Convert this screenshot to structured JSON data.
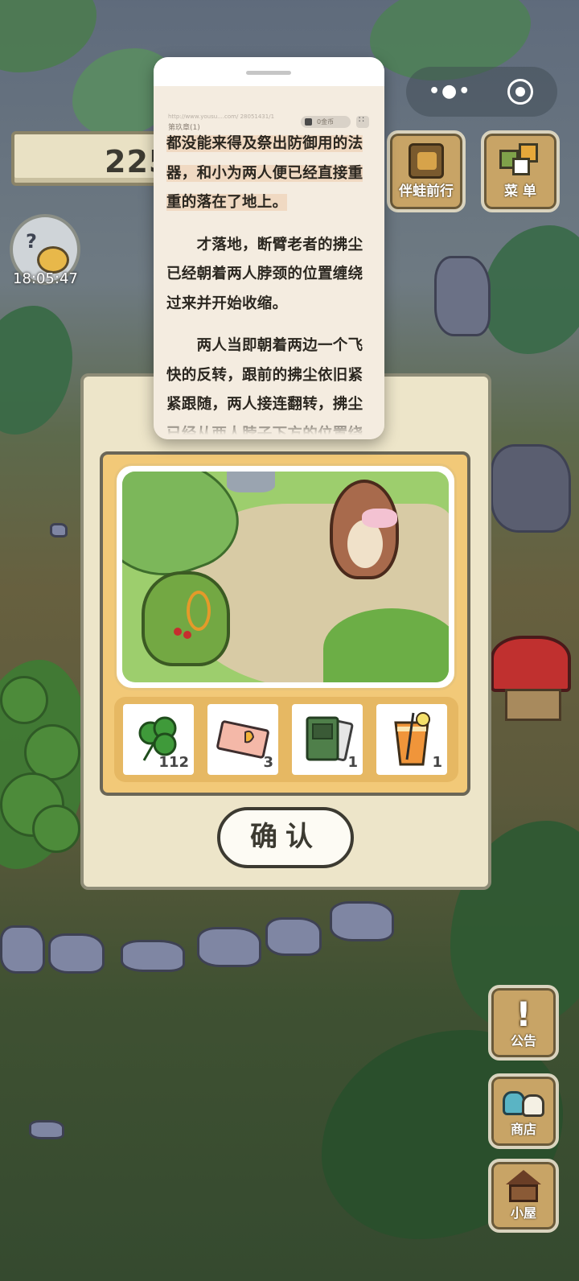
{
  "app": {
    "score": "225",
    "clock_time": "18:05:47"
  },
  "top_buttons": {
    "companion_label": "伴蛙前行",
    "menu_label": "菜 单"
  },
  "reader": {
    "url": "http://www.yousu....com/  28051431/1",
    "chapter": "第玖章(1)",
    "coins": "0金币",
    "paragraphs": [
      "都没能来得及祭出防御用的法器，和小为两人便已经直接重重的落在了地上。",
      "　　才落地，断臂老者的拂尘已经朝着两人脖颈的位置缠绕过来并开始收缩。",
      "　　两人当即朝着两边一个飞快的反转，跟前的拂尘依旧紧紧跟随，两人接连翻转，拂尘已经从两人脖子下方的位置绕了"
    ]
  },
  "reward": {
    "items": [
      {
        "icon": "clover-icon",
        "quantity": "112"
      },
      {
        "icon": "ticket-icon",
        "quantity": "3"
      },
      {
        "icon": "book-icon",
        "quantity": "1"
      },
      {
        "icon": "drink-icon",
        "quantity": "1"
      }
    ],
    "confirm_label": "确认"
  },
  "side_buttons": {
    "notice_label": "公告",
    "shop_label": "商店",
    "house_label": "小屋"
  },
  "colors": {
    "panel_bg": "#ede5c9",
    "tray_bg": "#f2c978",
    "wood": "#c8a466",
    "reader_bg": "#f4ece0"
  }
}
